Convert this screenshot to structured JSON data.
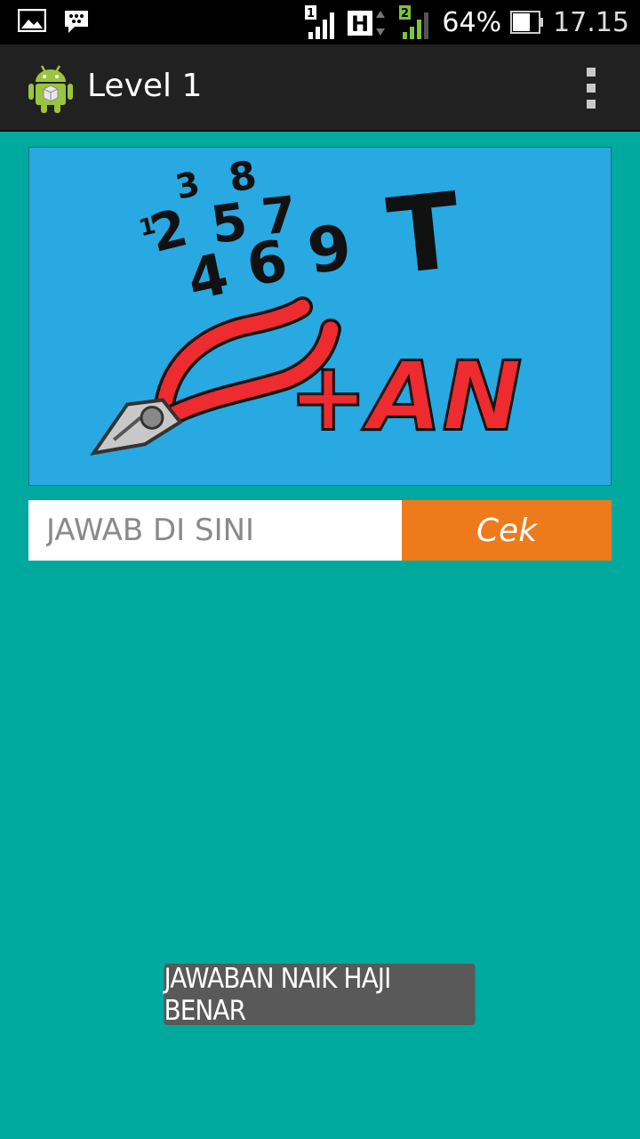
{
  "status_bar": {
    "icons": [
      "gallery-icon",
      "bbm-icon",
      "sim1-signal-icon",
      "hspa-icon",
      "sim2-signal-icon",
      "battery-icon"
    ],
    "sim1_label": "1",
    "network_label": "H",
    "sim2_label": "2",
    "battery": "64%",
    "time": "17.15"
  },
  "action_bar": {
    "title": "Level 1",
    "icon": "android-app-icon",
    "menu_icon": "overflow-menu-icon"
  },
  "puzzle": {
    "digits": [
      "3",
      "8",
      "1",
      "2",
      "5",
      "7",
      "4",
      "6",
      "9"
    ],
    "letter": "T",
    "plus_text": "+AN",
    "image_subject": "pliers",
    "colors": {
      "background": "#28a9e1",
      "ink": "#111111",
      "red": "#ee2b2e",
      "metal": "#c8c8c8"
    }
  },
  "answer": {
    "placeholder": "JAWAB DI SINI",
    "value": "",
    "button_label": "Cek"
  },
  "toast": {
    "message": "JAWABAN NAIK HAJI BENAR"
  },
  "colors": {
    "background": "#00a99d",
    "action_bar": "#212121",
    "button": "#ed7a1b",
    "toast": "#595959"
  }
}
